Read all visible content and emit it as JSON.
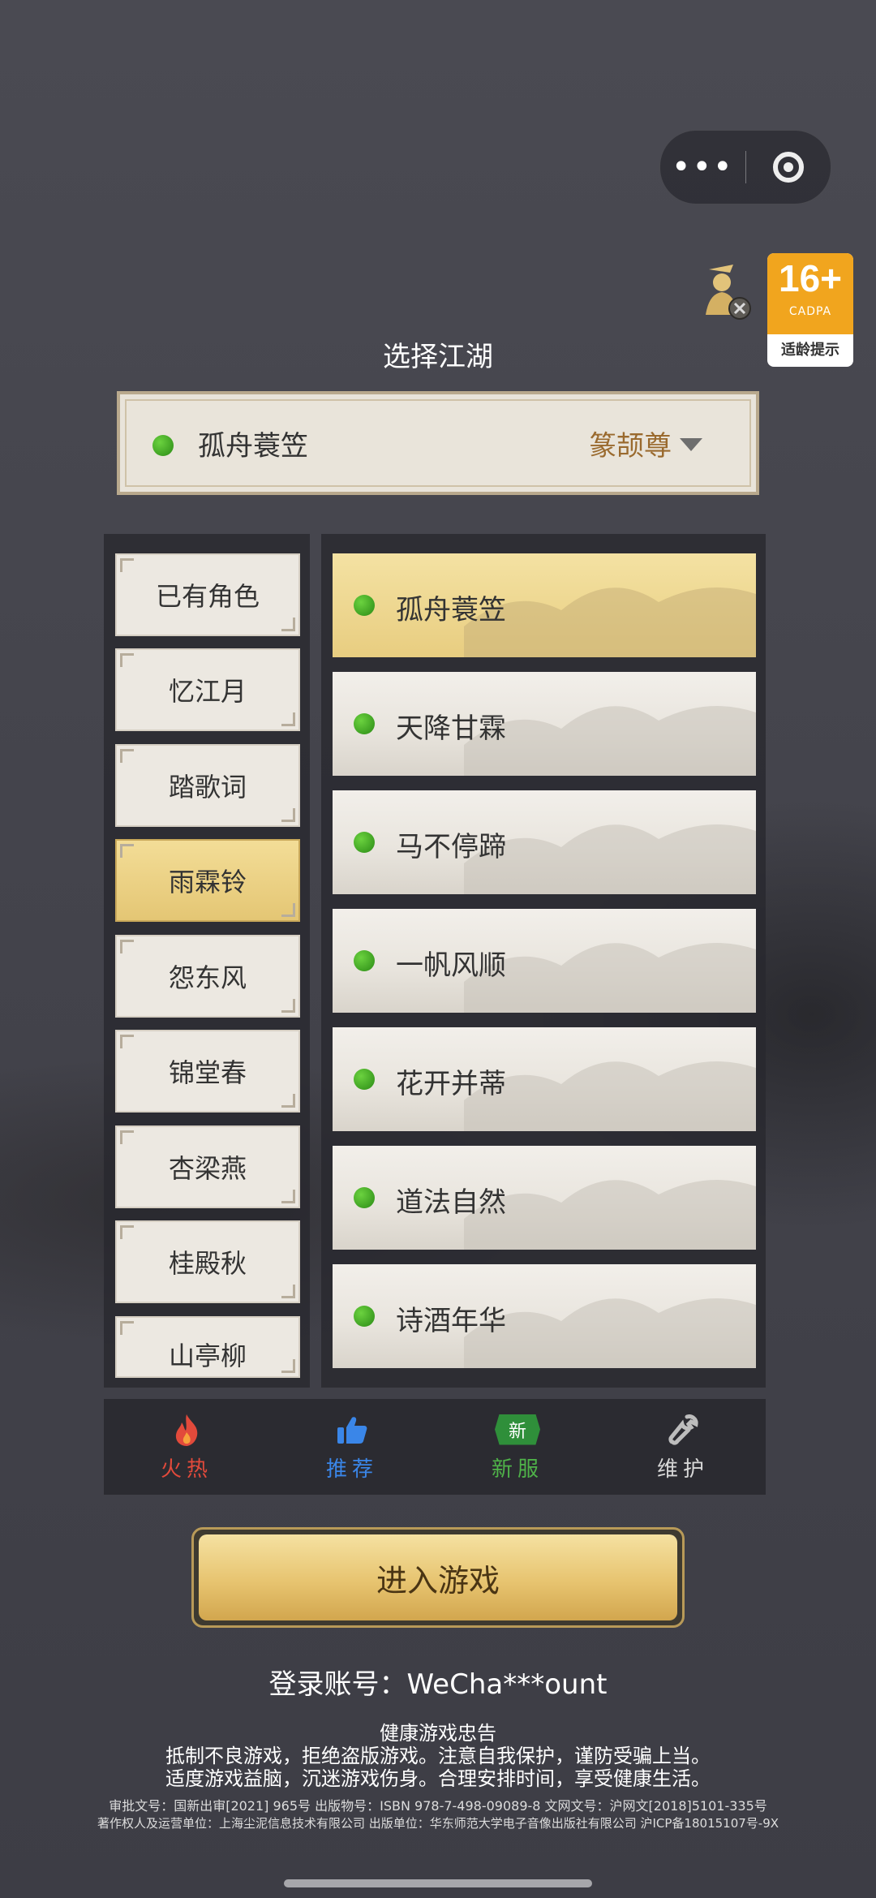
{
  "top_bar": {
    "more_icon": "more-dots-icon",
    "close_icon": "target-circle-icon"
  },
  "age_rating": {
    "number": "16+",
    "org": "CADPA",
    "tip": "适龄提示"
  },
  "title": "选择江湖",
  "selected_server": {
    "name": "孤舟蓑笠",
    "tag": "篆颉尊"
  },
  "categories": [
    {
      "label": "已有角色",
      "active": false
    },
    {
      "label": "忆江月",
      "active": false
    },
    {
      "label": "踏歌词",
      "active": false
    },
    {
      "label": "雨霖铃",
      "active": true
    },
    {
      "label": "怨东风",
      "active": false
    },
    {
      "label": "锦堂春",
      "active": false
    },
    {
      "label": "杏梁燕",
      "active": false
    },
    {
      "label": "桂殿秋",
      "active": false
    },
    {
      "label": "山亭柳",
      "active": false
    }
  ],
  "servers": [
    {
      "name": "孤舟蓑笠",
      "active": true
    },
    {
      "name": "天降甘霖",
      "active": false
    },
    {
      "name": "马不停蹄",
      "active": false
    },
    {
      "name": "一帆风顺",
      "active": false
    },
    {
      "name": "花开并蒂",
      "active": false
    },
    {
      "name": "道法自然",
      "active": false
    },
    {
      "name": "诗酒年华",
      "active": false
    }
  ],
  "legend": [
    {
      "label": "火热",
      "icon": "fire-icon",
      "color": "#e24a3b"
    },
    {
      "label": "推荐",
      "icon": "thumbs-up-icon",
      "color": "#3a86e8"
    },
    {
      "label": "新服",
      "icon": "new-badge-icon",
      "badge": "新",
      "color": "#4fb349"
    },
    {
      "label": "维护",
      "icon": "wrench-icon",
      "color": "#d8d8d8"
    }
  ],
  "enter_button": "进入游戏",
  "account": "登录账号：WeCha***ount",
  "notice": {
    "title": "健康游戏忠告",
    "line1": "抵制不良游戏，拒绝盗版游戏。注意自我保护，谨防受骗上当。",
    "line2": "适度游戏益脑，沉迷游戏伤身。合理安排时间，享受健康生活。"
  },
  "legal": {
    "line1": "审批文号：国新出审[2021] 965号    出版物号：ISBN 978-7-498-09089-8    文网文号：沪网文[2018]5101-335号",
    "line2": "著作权人及运营单位：上海尘泥信息技术有限公司    出版单位：华东师范大学电子音像出版社有限公司    沪ICP备18015107号-9X"
  },
  "colors": {
    "accent_gold": "#e7c470",
    "status_green": "#3aa620",
    "bg": "#45454d"
  }
}
